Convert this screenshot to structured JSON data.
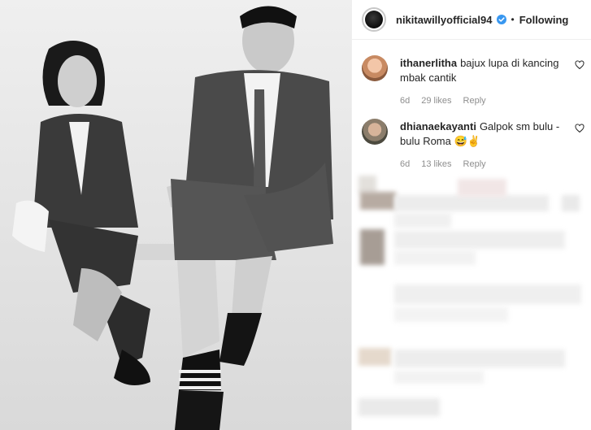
{
  "post": {
    "username": "nikitawillyofficial94",
    "separator": "•",
    "follow_status": "Following",
    "verified_icon": "verified-badge-icon",
    "colors": {
      "verified": "#3897f0",
      "meta": "#8e8e8e",
      "text": "#262626"
    }
  },
  "comments": [
    {
      "username": "ithanerlitha",
      "text": "bajux lupa di kancing mbak cantik",
      "age": "6d",
      "likes": "29 likes",
      "reply": "Reply"
    },
    {
      "username": "dhianaekayanti",
      "text": "Galpok sm bulu - bulu Roma 😅✌",
      "age": "6d",
      "likes": "13 likes",
      "reply": "Reply"
    }
  ]
}
